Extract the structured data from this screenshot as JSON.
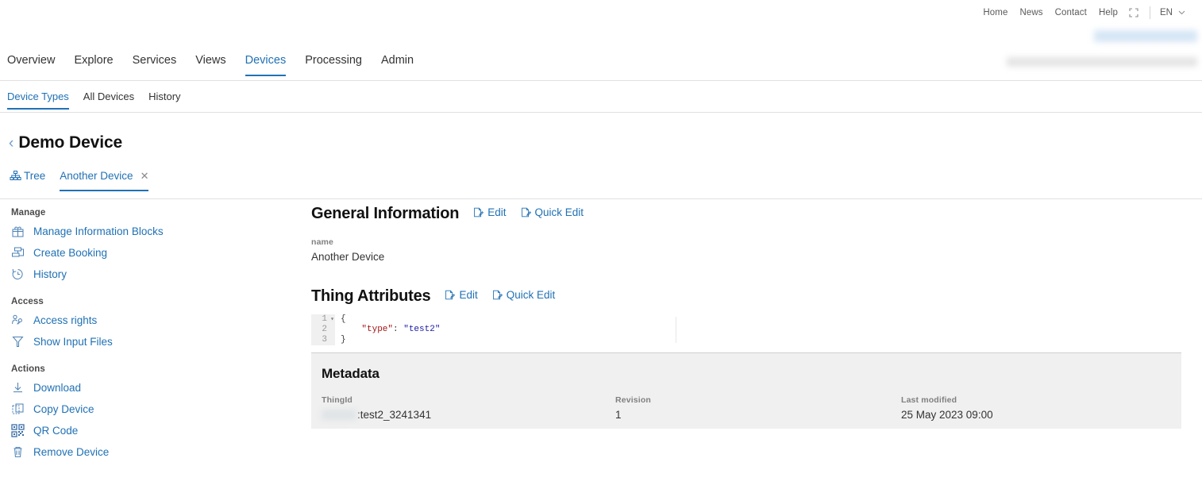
{
  "topbar": {
    "links": [
      {
        "label": "Home",
        "name": "home"
      },
      {
        "label": "News",
        "name": "news"
      },
      {
        "label": "Contact",
        "name": "contact"
      },
      {
        "label": "Help",
        "name": "help"
      }
    ],
    "fullscreen_icon": "fullscreen-icon",
    "language": "EN",
    "language_chevron_icon": "chevron-down-icon"
  },
  "mainnav": {
    "items": [
      {
        "label": "Overview",
        "active": false
      },
      {
        "label": "Explore",
        "active": false
      },
      {
        "label": "Services",
        "active": false
      },
      {
        "label": "Views",
        "active": false
      },
      {
        "label": "Devices",
        "active": true
      },
      {
        "label": "Processing",
        "active": false
      },
      {
        "label": "Admin",
        "active": false
      }
    ]
  },
  "subnav": {
    "items": [
      {
        "label": "Device Types",
        "active": true
      },
      {
        "label": "All Devices",
        "active": false
      },
      {
        "label": "History",
        "active": false
      }
    ]
  },
  "page": {
    "back_icon": "chevron-left-icon",
    "title": "Demo Device"
  },
  "device_tabs": {
    "items": [
      {
        "label": "Tree",
        "icon": "tree-hierarchy-icon",
        "active": false,
        "closable": false
      },
      {
        "label": "Another Device",
        "icon": "",
        "active": true,
        "closable": true,
        "close_icon": "close-icon"
      }
    ]
  },
  "sidebar": {
    "groups": [
      {
        "title": "Manage",
        "items": [
          {
            "label": "Manage Information Blocks",
            "icon": "information-block-icon"
          },
          {
            "label": "Create Booking",
            "icon": "booking-icon"
          },
          {
            "label": "History",
            "icon": "history-clock-icon"
          }
        ]
      },
      {
        "title": "Access",
        "items": [
          {
            "label": "Access rights",
            "icon": "user-key-icon"
          },
          {
            "label": "Show Input Files",
            "icon": "filter-funnel-icon"
          }
        ]
      },
      {
        "title": "Actions",
        "items": [
          {
            "label": "Download",
            "icon": "download-icon"
          },
          {
            "label": "Copy Device",
            "icon": "copy-icon"
          },
          {
            "label": "QR Code",
            "icon": "qr-code-icon"
          },
          {
            "label": "Remove Device",
            "icon": "trash-icon"
          }
        ]
      }
    ]
  },
  "general_information": {
    "heading": "General Information",
    "edit_label": "Edit",
    "quick_edit_label": "Quick Edit",
    "edit_icon": "edit-document-icon",
    "name_label": "name",
    "name_value": "Another Device"
  },
  "thing_attributes": {
    "heading": "Thing Attributes",
    "edit_label": "Edit",
    "quick_edit_label": "Quick Edit",
    "edit_icon": "edit-document-icon",
    "editor": {
      "line_numbers": [
        "1",
        "2",
        "3"
      ],
      "fold_marker": "▾",
      "lines": [
        {
          "plain": "{"
        },
        {
          "indent": "    ",
          "key": "\"type\"",
          "colon": ": ",
          "value": "\"test2\""
        },
        {
          "plain": "}"
        }
      ]
    }
  },
  "metadata": {
    "heading": "Metadata",
    "thingid_label": "ThingId",
    "thingid_value": ":test2_3241341",
    "revision_label": "Revision",
    "revision_value": "1",
    "last_modified_label": "Last modified",
    "last_modified_value": "25 May 2023 09:00"
  },
  "colors": {
    "accent": "#2071b5",
    "text": "#333333",
    "muted": "#808080",
    "panel": "#f0f0f0",
    "border": "#e0e0e0",
    "json_key": "#a31515",
    "json_string": "#1a1aa6"
  }
}
